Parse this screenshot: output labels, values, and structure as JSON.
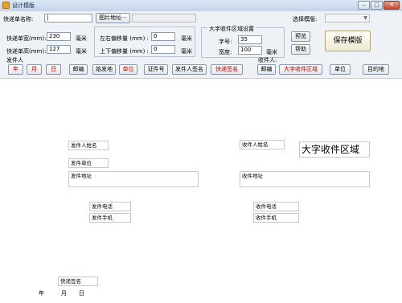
{
  "window": {
    "title": "设计模版",
    "minimize": "–",
    "maximize": "□",
    "close": "✕"
  },
  "toolbar": {
    "tracking_name_label": "快递单名称:",
    "tracking_name_value": "|",
    "image_address_button": "图片地址···",
    "select_template_label": "选择模版:",
    "select_template_value": ""
  },
  "size": {
    "width_label": "快递单宽(mm):",
    "width_value": "230",
    "width_unit": "毫米",
    "height_label": "快递单高(mm):",
    "height_value": "127",
    "height_unit": "毫米"
  },
  "offset": {
    "lr_label": "左右偏移量 (mm) :",
    "lr_value": "0",
    "lr_unit": "毫米",
    "ud_label": "上下偏移量 (mm) :",
    "ud_value": "0",
    "ud_unit": "毫米"
  },
  "big_area": {
    "legend": "大字收件区域设置",
    "font_label": "字号:",
    "font_value": "35",
    "width_label": "宽度:",
    "width_value": "100",
    "width_unit": "毫米"
  },
  "actions": {
    "preview": "预览",
    "help": "帮助",
    "save_template": "保存模版"
  },
  "sender": {
    "section_label": "发件人",
    "buttons": [
      "年",
      "月",
      "日",
      "邮编",
      "始发地",
      "单位",
      "证件号",
      "发件人签名",
      "快递签名"
    ]
  },
  "receiver": {
    "section_label": "收件人:",
    "buttons": [
      "邮编",
      "大字收件区域",
      "单位",
      "目的地"
    ]
  },
  "canvas": {
    "sender_name": "发件人姓名",
    "sender_company": "发件单位",
    "sender_address": "发件地址",
    "sender_phone": "发件电话",
    "sender_mobile": "发件手机",
    "receiver_name": "收件人姓名",
    "big_receiver_area": "大字收件区域",
    "receiver_address": "收件地址",
    "receiver_phone": "收件电话",
    "receiver_mobile": "收件手机",
    "courier_signature": "快递签名",
    "year": "年",
    "month": "月",
    "day": "日"
  }
}
